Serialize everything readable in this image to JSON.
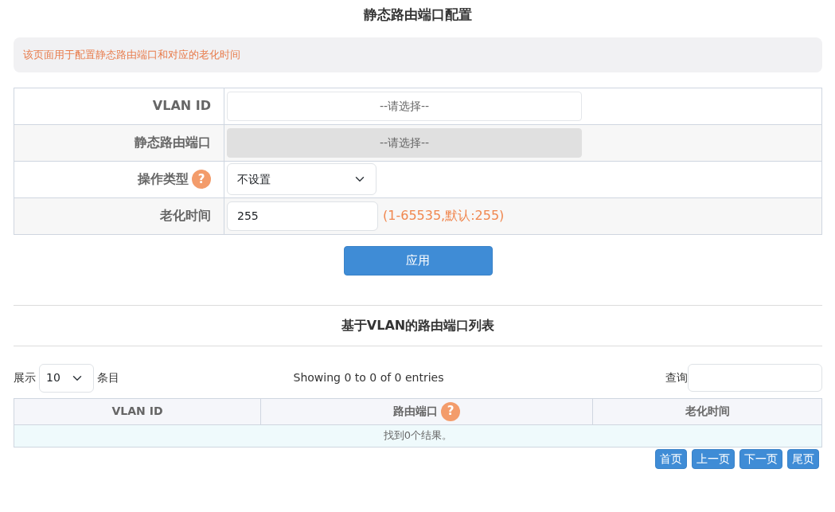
{
  "title": "静态路由端口配置",
  "notice": "该页面用于配置静态路由端口和对应的老化时间",
  "form": [
    {
      "label": "VLAN ID",
      "kind": "picker",
      "value": "--请选择--",
      "disabled": false
    },
    {
      "label": "静态路由端口",
      "kind": "picker",
      "value": "--请选择--",
      "disabled": true
    },
    {
      "label": "操作类型",
      "help": "?",
      "kind": "select",
      "value": "不设置",
      "disabled": false
    },
    {
      "label": "老化时间",
      "kind": "input",
      "value": "255",
      "hint": "(1-65535,默认:255)",
      "disabled": false
    }
  ],
  "apply_button": "应用",
  "list": {
    "title": "基于VLAN的路由端口列表",
    "show_label": "展示",
    "page_size": "10",
    "entries_label": "条目",
    "info": "Showing 0 to 0 of 0 entries",
    "search_label": "查询",
    "columns": [
      {
        "label": "VLAN ID"
      },
      {
        "label": "路由端口",
        "help": "?"
      },
      {
        "label": "老化时间"
      }
    ],
    "empty": "找到0个结果。",
    "pager": [
      "首页",
      "上一页",
      "下一页",
      "尾页"
    ]
  }
}
